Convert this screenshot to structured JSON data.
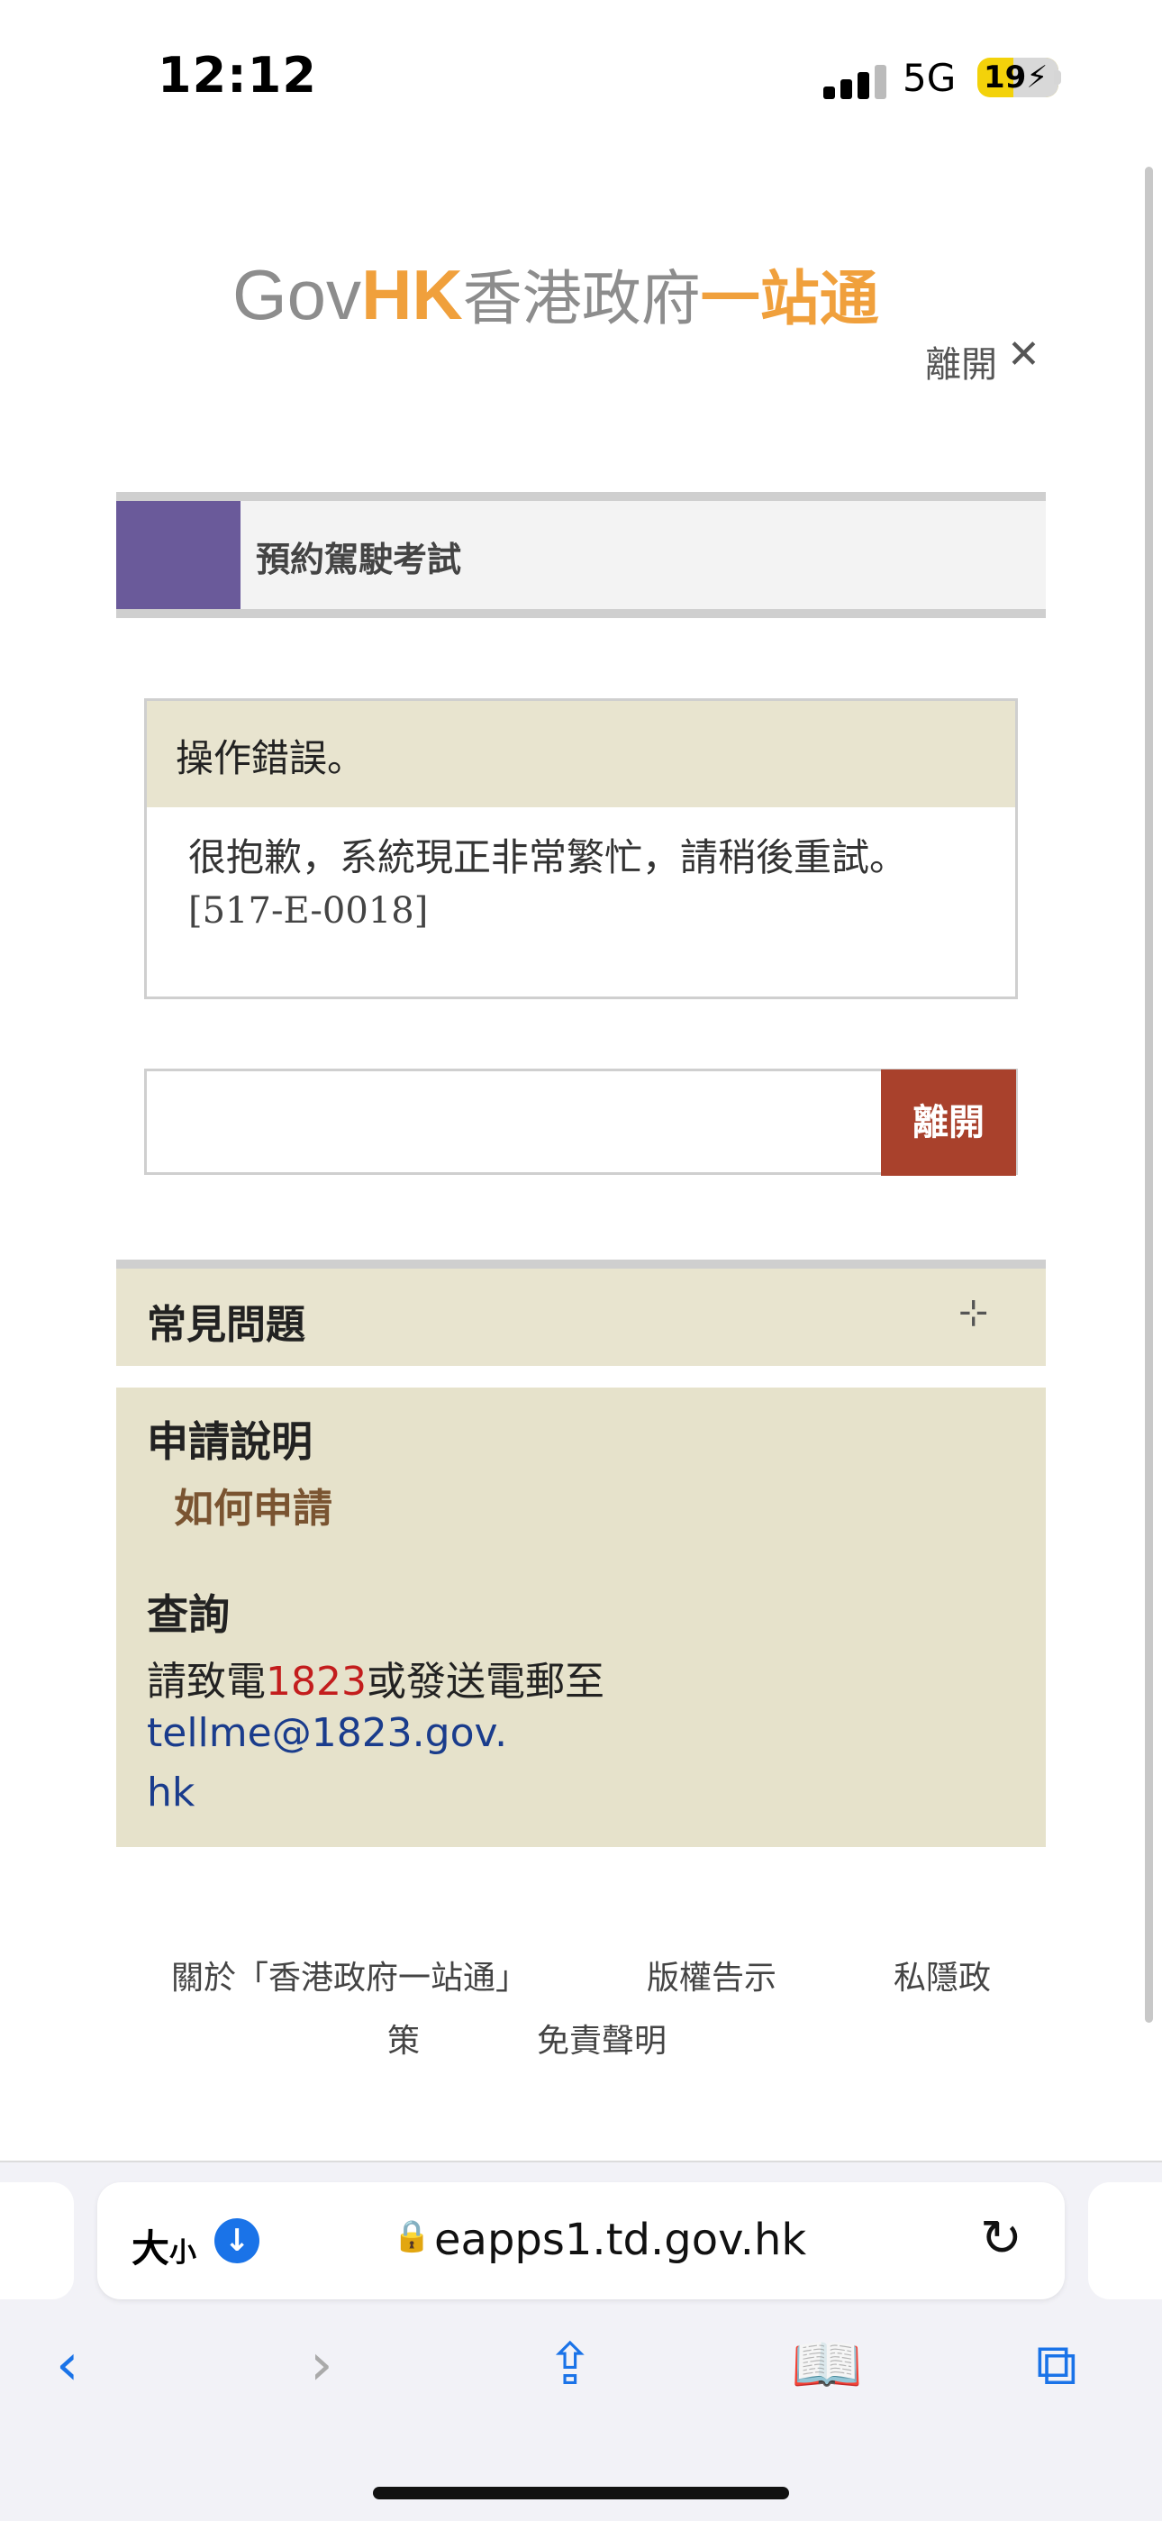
{
  "status_bar": {
    "time": "12:12",
    "network": "5G",
    "battery": "19"
  },
  "header": {
    "logo_gov": "Gov",
    "logo_hk": "HK",
    "logo_cn_a": "香港政府",
    "logo_cn_b": "一站通",
    "exit_label": "離開",
    "exit_icon": "close-icon"
  },
  "page": {
    "title": "預約駕駛考試"
  },
  "error": {
    "title": "操作錯誤。",
    "message": "很抱歉，系統現正非常繁忙，請稍後重試。",
    "code": "[517-E-0018]"
  },
  "actions": {
    "exit_button": "離開"
  },
  "faq": {
    "title": "常見問題",
    "toggle_icon": "expand-icon"
  },
  "info": {
    "section1_title": "申請說明",
    "how_to_apply": "如何申請",
    "section2_title": "查詢",
    "contact_prefix": "請致電",
    "phone": "1823",
    "contact_suffix": "或發送電郵至",
    "email_line1": "tellme@1823.gov.",
    "email_line2": "hk"
  },
  "footer": {
    "about": "關於「香港政府一站通」",
    "copyright": "版權告示",
    "privacy_a": "私隱政",
    "privacy_b": "策",
    "disclaimer": "免責聲明"
  },
  "browser": {
    "text_size_label": "大",
    "text_size_small": "小",
    "url": "eapps1.td.gov.hk",
    "accent_color": "#1a73e8"
  },
  "colors": {
    "title_accent": "#6a5a9a",
    "exit_button": "#a9412c",
    "panel_beige": "#e6e2cb",
    "phone_red": "#c31d1d",
    "email_blue": "#1a3c8c",
    "logo_orange": "#f0a03c"
  }
}
